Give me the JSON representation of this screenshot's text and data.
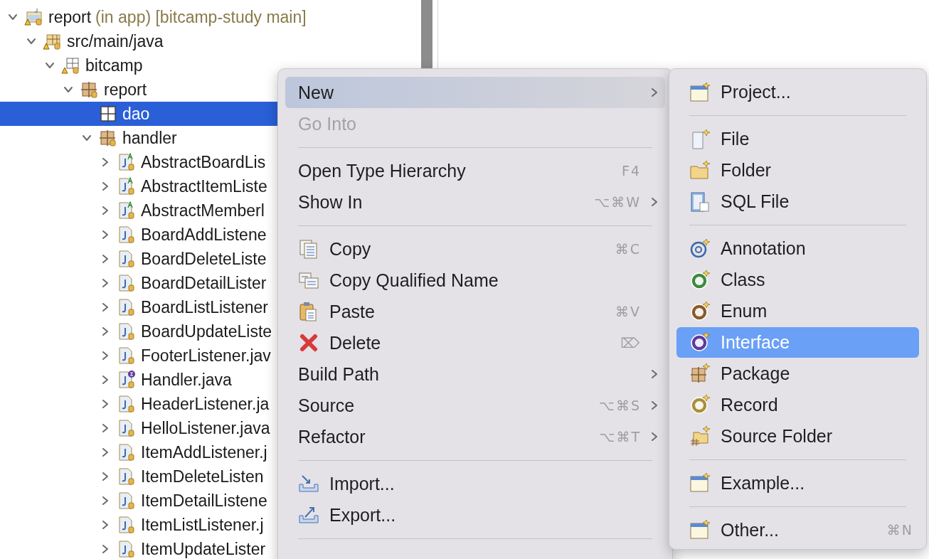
{
  "tree": [
    {
      "label": "report",
      "note": "(in app) [bitcamp-study main]",
      "kind": "project",
      "expanded": true,
      "selected": false,
      "children": [
        {
          "label": "src/main/java",
          "kind": "source-folder",
          "expanded": true,
          "selected": false,
          "children": [
            {
              "label": "bitcamp",
              "kind": "empty-package",
              "expanded": true,
              "selected": false,
              "children": [
                {
                  "label": "report",
                  "kind": "package",
                  "expanded": true,
                  "selected": false,
                  "children": [
                    {
                      "label": "dao",
                      "kind": "plain-package",
                      "selected": true
                    },
                    {
                      "label": "handler",
                      "kind": "package",
                      "expanded": true,
                      "selected": false,
                      "children": [
                        {
                          "label": "AbstractBoardLis",
                          "kind": "abstract-class",
                          "expanded": false,
                          "selected": false
                        },
                        {
                          "label": "AbstractItemListe",
                          "kind": "abstract-class",
                          "expanded": false,
                          "selected": false
                        },
                        {
                          "label": "AbstractMemberl",
                          "kind": "abstract-class",
                          "expanded": false,
                          "selected": false
                        },
                        {
                          "label": "BoardAddListene",
                          "kind": "class",
                          "expanded": false,
                          "selected": false
                        },
                        {
                          "label": "BoardDeleteListe",
                          "kind": "class",
                          "expanded": false,
                          "selected": false
                        },
                        {
                          "label": "BoardDetailLister",
                          "kind": "class",
                          "expanded": false,
                          "selected": false
                        },
                        {
                          "label": "BoardListListener",
                          "kind": "class",
                          "expanded": false,
                          "selected": false
                        },
                        {
                          "label": "BoardUpdateListe",
                          "kind": "class",
                          "expanded": false,
                          "selected": false
                        },
                        {
                          "label": "FooterListener.jav",
                          "kind": "class",
                          "expanded": false,
                          "selected": false
                        },
                        {
                          "label": "Handler.java",
                          "kind": "interface",
                          "expanded": false,
                          "selected": false
                        },
                        {
                          "label": "HeaderListener.ja",
                          "kind": "class",
                          "expanded": false,
                          "selected": false
                        },
                        {
                          "label": "HelloListener.java",
                          "kind": "class",
                          "expanded": false,
                          "selected": false
                        },
                        {
                          "label": "ItemAddListener.j",
                          "kind": "class",
                          "expanded": false,
                          "selected": false
                        },
                        {
                          "label": "ItemDeleteListen",
                          "kind": "class",
                          "expanded": false,
                          "selected": false
                        },
                        {
                          "label": "ItemDetailListene",
                          "kind": "class",
                          "expanded": false,
                          "selected": false
                        },
                        {
                          "label": "ItemListListener.j",
                          "kind": "class",
                          "expanded": false,
                          "selected": false
                        },
                        {
                          "label": "ItemUpdateLister",
                          "kind": "class",
                          "expanded": false,
                          "selected": false
                        }
                      ]
                    }
                  ]
                }
              ]
            }
          ]
        }
      ]
    }
  ],
  "context_menu": {
    "items": [
      {
        "kind": "item",
        "label": "New",
        "submenu": true,
        "selected": true,
        "disabled": false
      },
      {
        "kind": "item",
        "label": "Go Into",
        "submenu": false,
        "selected": false,
        "disabled": true
      },
      {
        "kind": "separator"
      },
      {
        "kind": "item",
        "label": "Open Type Hierarchy",
        "shortcut": "F4",
        "submenu": false,
        "selected": false,
        "disabled": false
      },
      {
        "kind": "item",
        "label": "Show In",
        "shortcut": "⌥⌘W",
        "submenu": true,
        "selected": false,
        "disabled": false
      },
      {
        "kind": "separator"
      },
      {
        "kind": "item",
        "label": "Copy",
        "shortcut": "⌘C",
        "submenu": false,
        "selected": false,
        "disabled": false
      },
      {
        "kind": "item",
        "label": "Copy Qualified Name",
        "submenu": false,
        "selected": false,
        "disabled": false
      },
      {
        "kind": "item",
        "label": "Paste",
        "shortcut": "⌘V",
        "submenu": false,
        "selected": false,
        "disabled": false
      },
      {
        "kind": "item",
        "label": "Delete",
        "shortcut": "⌦",
        "submenu": false,
        "selected": false,
        "disabled": false
      },
      {
        "kind": "item",
        "label": "Build Path",
        "submenu": true,
        "selected": false,
        "disabled": false
      },
      {
        "kind": "item",
        "label": "Source",
        "shortcut": "⌥⌘S",
        "submenu": true,
        "selected": false,
        "disabled": false
      },
      {
        "kind": "item",
        "label": "Refactor",
        "shortcut": "⌥⌘T",
        "submenu": true,
        "selected": false,
        "disabled": false
      },
      {
        "kind": "separator"
      },
      {
        "kind": "item",
        "label": "Import...",
        "submenu": false,
        "selected": false,
        "disabled": false
      },
      {
        "kind": "item",
        "label": "Export...",
        "submenu": false,
        "selected": false,
        "disabled": false
      },
      {
        "kind": "separator"
      }
    ]
  },
  "new_submenu": {
    "items": [
      {
        "kind": "item",
        "label": "Project...",
        "selected": false
      },
      {
        "kind": "separator"
      },
      {
        "kind": "item",
        "label": "File",
        "selected": false
      },
      {
        "kind": "item",
        "label": "Folder",
        "selected": false
      },
      {
        "kind": "item",
        "label": "SQL File",
        "selected": false
      },
      {
        "kind": "separator"
      },
      {
        "kind": "item",
        "label": "Annotation",
        "selected": false
      },
      {
        "kind": "item",
        "label": "Class",
        "selected": false
      },
      {
        "kind": "item",
        "label": "Enum",
        "selected": false
      },
      {
        "kind": "item",
        "label": "Interface",
        "selected": true
      },
      {
        "kind": "item",
        "label": "Package",
        "selected": false
      },
      {
        "kind": "item",
        "label": "Record",
        "selected": false
      },
      {
        "kind": "item",
        "label": "Source Folder",
        "selected": false
      },
      {
        "kind": "separator"
      },
      {
        "kind": "item",
        "label": "Example...",
        "selected": false
      },
      {
        "kind": "separator"
      },
      {
        "kind": "item",
        "label": "Other...",
        "shortcut": "⌘N",
        "selected": false
      }
    ]
  }
}
